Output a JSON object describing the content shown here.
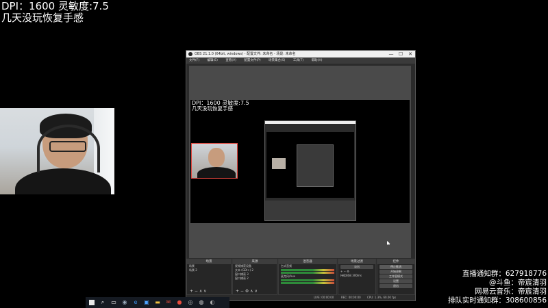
{
  "overlay": {
    "dpi_line": "DPI：1600 灵敏度:7.5",
    "subtitle": "几天没玩恢复手感"
  },
  "obs": {
    "title": "OBS 21.1.0 (64bit, windows) - 配置文件: 未命名 - 场景: 未命名",
    "window_controls": {
      "minimize": "—",
      "maximize": "☐",
      "close": "✕"
    },
    "menu": [
      "文件(F)",
      "编辑(E)",
      "查看(V)",
      "配置文件(P)",
      "场景集合(S)",
      "工具(T)",
      "帮助(H)"
    ],
    "preview_text": {
      "dpi_line": "DPI：1600 灵敏度:7.5",
      "subtitle": "几天没玩恢复手感"
    },
    "docks": {
      "scenes": {
        "header": "场景",
        "items": [
          "场景",
          "场景 2"
        ],
        "controls": "+ − ∧ ∨"
      },
      "sources": {
        "header": "来源",
        "items": [
          "视频捕获设备",
          "文本 (GDI+) 2",
          "窗口捕获 3",
          "窗口捕获 2"
        ],
        "controls": "+ − ⚙ ∧ ∨"
      },
      "mixer": {
        "header": "混音器",
        "items": [
          "台式音频",
          "麦克风/Aux"
        ]
      },
      "transitions": {
        "header": "场景过渡",
        "fade": "淡出",
        "duration_label": "持续时间",
        "duration_value": "300ms"
      },
      "controls": {
        "header": "控件",
        "buttons": [
          "停止推流",
          "开始录制",
          "工作室模式",
          "设置",
          "退出"
        ]
      }
    },
    "status": {
      "live": "LIVE: 00:00:00",
      "rec": "REC: 00:00:00",
      "cpu": "CPU: 1.3%, 60.00 fps"
    }
  },
  "bottom_overlay": {
    "line1": "直播通知群：627918776",
    "line2": "@斗鱼：帝宸清羽",
    "line3": "网易云音乐：帝宸清羽",
    "line4": "排队实时通知群：308600856"
  },
  "taskbar": {
    "icons": [
      "windows-start-icon",
      "search-icon",
      "task-view-icon",
      "steam-icon",
      "edge-icon",
      "store-icon",
      "folder-icon",
      "chrome-icon",
      "mail-icon",
      "obs-icon",
      "browser-icon"
    ]
  },
  "colors": {
    "background": "#000000",
    "obs_dark": "#2b2b2b",
    "accent_red": "#e0463d"
  }
}
